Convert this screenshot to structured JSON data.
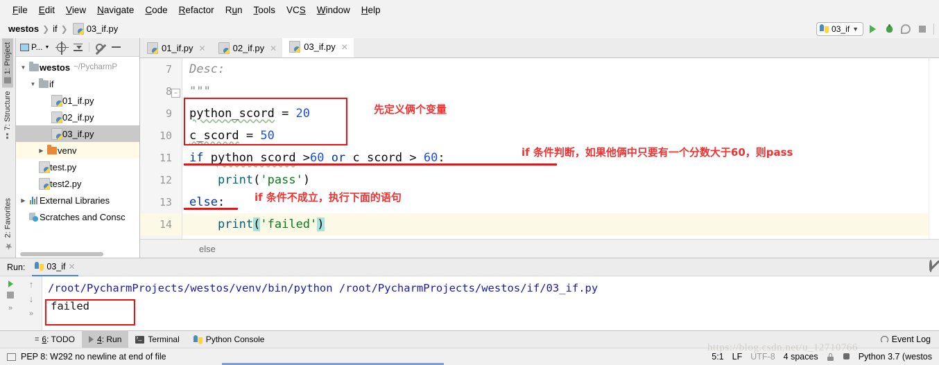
{
  "menubar": {
    "items": [
      "File",
      "Edit",
      "View",
      "Navigate",
      "Code",
      "Refactor",
      "Run",
      "Tools",
      "VCS",
      "Window",
      "Help"
    ]
  },
  "navbar": {
    "crumbs": [
      "westos",
      "if",
      "03_if.py"
    ],
    "run_config": "03_if",
    "icons": [
      "python-icon",
      "chevron-down-icon",
      "run-icon",
      "debug-icon",
      "coverage-icon",
      "stop-icon"
    ]
  },
  "left_strip": {
    "tabs": [
      {
        "label": "1: Project",
        "icon": "project-icon",
        "selected": true
      },
      {
        "label": "7: Structure",
        "icon": "structure-icon",
        "selected": false
      },
      {
        "label": "2: Favorites",
        "icon": "star-icon",
        "selected": false
      }
    ]
  },
  "project_panel": {
    "header_label": "P...",
    "header_icons": [
      "project-view-icon",
      "locate-icon",
      "collapse-all-icon",
      "settings-icon",
      "hide-icon"
    ],
    "tree": [
      {
        "indent": 0,
        "arrow": "down",
        "icon": "folder-icon",
        "label": "westos",
        "bold": true,
        "path": "~/PycharmP",
        "state": "normal"
      },
      {
        "indent": 1,
        "arrow": "down",
        "icon": "folder-icon",
        "label": "if",
        "bold": false,
        "path": "",
        "state": "normal"
      },
      {
        "indent": 2,
        "arrow": "none",
        "icon": "python-file-icon",
        "label": "01_if.py",
        "bold": false,
        "path": "",
        "state": "normal"
      },
      {
        "indent": 2,
        "arrow": "none",
        "icon": "python-file-icon",
        "label": "02_if.py",
        "bold": false,
        "path": "",
        "state": "normal"
      },
      {
        "indent": 2,
        "arrow": "none",
        "icon": "python-file-icon",
        "label": "03_if.py",
        "bold": false,
        "path": "",
        "state": "selected"
      },
      {
        "indent": 1,
        "arrow": "right",
        "icon": "folder-orange-icon",
        "label": "venv",
        "bold": false,
        "path": "",
        "state": "highlighted"
      },
      {
        "indent": 1,
        "arrow": "none",
        "icon": "python-file-icon",
        "label": "test.py",
        "bold": false,
        "path": "",
        "state": "normal"
      },
      {
        "indent": 1,
        "arrow": "none",
        "icon": "python-file-icon",
        "label": "test2.py",
        "bold": false,
        "path": "",
        "state": "normal"
      },
      {
        "indent": 0,
        "arrow": "right",
        "icon": "libraries-icon",
        "label": "External Libraries",
        "bold": false,
        "path": "",
        "state": "normal"
      },
      {
        "indent": 0,
        "arrow": "none",
        "icon": "scratches-icon",
        "label": "Scratches and Consc",
        "bold": false,
        "path": "",
        "state": "normal"
      }
    ]
  },
  "editor": {
    "tabs": [
      {
        "label": "01_if.py",
        "active": false
      },
      {
        "label": "02_if.py",
        "active": false
      },
      {
        "label": "03_if.py",
        "active": true
      }
    ],
    "line_numbers": [
      "7",
      "8",
      "9",
      "10",
      "11",
      "12",
      "13",
      "14"
    ],
    "code_lines": [
      {
        "n": "7",
        "text": "Desc:"
      },
      {
        "n": "8",
        "text": "\"\"\""
      },
      {
        "n": "9",
        "text": "python_scord = 20"
      },
      {
        "n": "10",
        "text": "c_scord = 50"
      },
      {
        "n": "11",
        "text": "if python_scord >60 or c_scord > 60:"
      },
      {
        "n": "12",
        "text": "    print('pass')"
      },
      {
        "n": "13",
        "text": "else:"
      },
      {
        "n": "14",
        "text": "    print('failed')"
      }
    ],
    "annotations": [
      {
        "text": "先定义俩个变量",
        "line": 9
      },
      {
        "text": "if 条件判断，如果他俩中只要有一个分数大于60，则pass",
        "line": 11
      },
      {
        "text": "if 条件不成立，执行下面的语句",
        "line": 13
      }
    ],
    "breadcrumb": "else",
    "annotation_color": "#f03232",
    "highlight_box_color": "#ee1111"
  },
  "run_panel": {
    "label": "Run:",
    "tab": "03_if",
    "command": "/root/PycharmProjects/westos/venv/bin/python /root/PycharmProjects/westos/if/03_if.py",
    "output": "failed",
    "tool_icons": [
      "rerun-icon",
      "stop-icon",
      "expand-icon",
      "scroll-up-icon",
      "scroll-down-icon",
      "soft-wrap-icon"
    ],
    "settings_icon": "gear-icon"
  },
  "bottom_bar": {
    "tabs": [
      {
        "label": "6: TODO",
        "icon": "todo-icon",
        "selected": false
      },
      {
        "label": "4: Run",
        "icon": "run-icon",
        "selected": true
      },
      {
        "label": "Terminal",
        "icon": "terminal-icon",
        "selected": false
      },
      {
        "label": "Python Console",
        "icon": "python-icon",
        "selected": false
      }
    ],
    "event_log": "Event Log",
    "event_log_icon": "balloon-icon"
  },
  "status_bar": {
    "inspection": "PEP 8: W292 no newline at end of file",
    "caret": "5:1",
    "line_separator": "LF",
    "encoding": "UTF-8",
    "indent": "4 spaces",
    "interpreter": "Python 3.7 (westos",
    "icons": [
      "lock-icon",
      "database-icon"
    ]
  },
  "watermark": "https://blog.csdn.net/u_12710766"
}
